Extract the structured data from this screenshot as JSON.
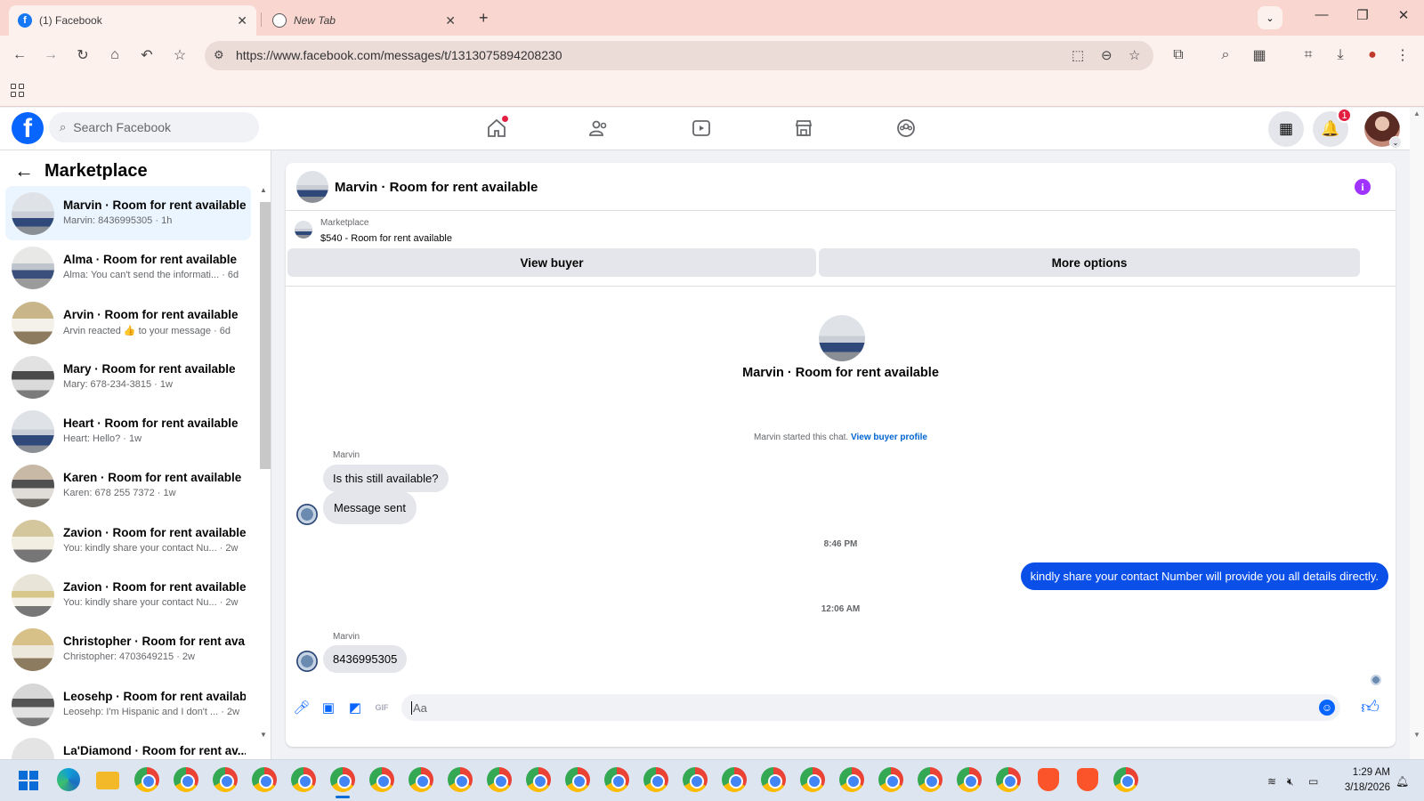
{
  "browser": {
    "tabs": [
      {
        "title": "(1) Facebook",
        "active": true
      },
      {
        "title": "New Tab",
        "active": false
      }
    ],
    "url": "https://www.facebook.com/messages/t/1313075894208230"
  },
  "fb_header": {
    "search_placeholder": "Search Facebook",
    "notification_count": "1"
  },
  "left_panel": {
    "title": "Marketplace",
    "conversations": [
      {
        "name": "Marvin · Room for rent available",
        "preview": "Marvin: 8436995305 · 1h"
      },
      {
        "name": "Alma · Room for rent available",
        "preview": "Alma: You can't send the informati... · 6d"
      },
      {
        "name": "Arvin · Room for rent available",
        "preview": "Arvin reacted 👍 to your message · 6d"
      },
      {
        "name": "Mary · Room for rent available",
        "preview": "Mary: 678-234-3815 · 1w"
      },
      {
        "name": "Heart · Room for rent available",
        "preview": "Heart: Hello? · 1w"
      },
      {
        "name": "Karen · Room for rent available",
        "preview": "Karen: 678 255 7372 · 1w"
      },
      {
        "name": "Zavion · Room for rent available",
        "preview": "You: kindly share your contact Nu... · 2w"
      },
      {
        "name": "Zavion · Room for rent available",
        "preview": "You: kindly share your contact Nu... · 2w"
      },
      {
        "name": "Christopher · Room for rent ava...",
        "preview": "Christopher: 4703649215 · 2w"
      },
      {
        "name": "Leosehp · Room for rent available",
        "preview": "Leosehp: I'm Hispanic and I don't ... · 2w"
      },
      {
        "name": "La'Diamond · Room for rent av...",
        "preview": ""
      }
    ]
  },
  "chat": {
    "title": "Marvin · Room for rent available",
    "marketplace_label": "Marketplace",
    "listing": "$540 - Room for rent available",
    "view_buyer": "View buyer",
    "more_options": "More options",
    "intro_name": "Marvin · Room for rent available",
    "started_text": "Marvin started this chat.",
    "started_link": "View buyer profile",
    "messages": [
      {
        "sender": "Marvin",
        "text": "Is this still available?"
      },
      {
        "text": "Message sent"
      },
      {
        "timestamp": "8:46 PM"
      },
      {
        "text": "kindly share your contact Number will provide you all details directly."
      },
      {
        "timestamp": "12:06 AM"
      },
      {
        "sender": "Marvin",
        "text": "8436995305"
      }
    ],
    "composer_placeholder": "Aa"
  },
  "taskbar": {
    "time": "1:29 AM",
    "date": "3/18/2026"
  }
}
